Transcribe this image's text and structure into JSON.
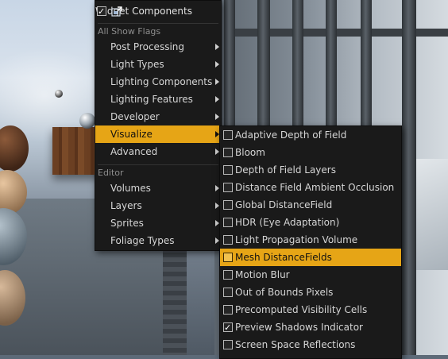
{
  "viewport": {
    "description": ""
  },
  "main_menu": {
    "widget_components": {
      "label": "Widget Components",
      "checked": true,
      "icon": "widget-components-icon"
    },
    "sections": [
      {
        "header": "All Show Flags",
        "items": [
          {
            "label": "Post Processing",
            "has_submenu": true
          },
          {
            "label": "Light Types",
            "has_submenu": true
          },
          {
            "label": "Lighting Components",
            "has_submenu": true
          },
          {
            "label": "Lighting Features",
            "has_submenu": true
          },
          {
            "label": "Developer",
            "has_submenu": true
          },
          {
            "label": "Visualize",
            "has_submenu": true,
            "highlighted": true
          },
          {
            "label": "Advanced",
            "has_submenu": true
          }
        ]
      },
      {
        "header": "Editor",
        "items": [
          {
            "label": "Volumes",
            "has_submenu": true
          },
          {
            "label": "Layers",
            "has_submenu": true
          },
          {
            "label": "Sprites",
            "has_submenu": true
          },
          {
            "label": "Foliage Types",
            "has_submenu": true
          }
        ]
      }
    ]
  },
  "visualize_submenu": {
    "items": [
      {
        "label": "Adaptive Depth of Field",
        "checked": false
      },
      {
        "label": "Bloom",
        "checked": false
      },
      {
        "label": "Depth of Field Layers",
        "checked": false
      },
      {
        "label": "Distance Field Ambient Occlusion",
        "checked": false
      },
      {
        "label": "Global DistanceField",
        "checked": false
      },
      {
        "label": "HDR (Eye Adaptation)",
        "checked": false
      },
      {
        "label": "Light Propagation Volume",
        "checked": false
      },
      {
        "label": "Mesh DistanceFields",
        "checked": false,
        "highlighted": true
      },
      {
        "label": "Motion Blur",
        "checked": false
      },
      {
        "label": "Out of Bounds Pixels",
        "checked": false
      },
      {
        "label": "Precomputed Visibility Cells",
        "checked": false
      },
      {
        "label": "Preview Shadows Indicator",
        "checked": true
      },
      {
        "label": "Screen Space Reflections",
        "checked": false
      }
    ]
  },
  "colors": {
    "highlight": "#e6a516",
    "menu_bg": "#1a1a1a",
    "text": "#d6d6d6",
    "section_text": "#8d8d8d"
  }
}
